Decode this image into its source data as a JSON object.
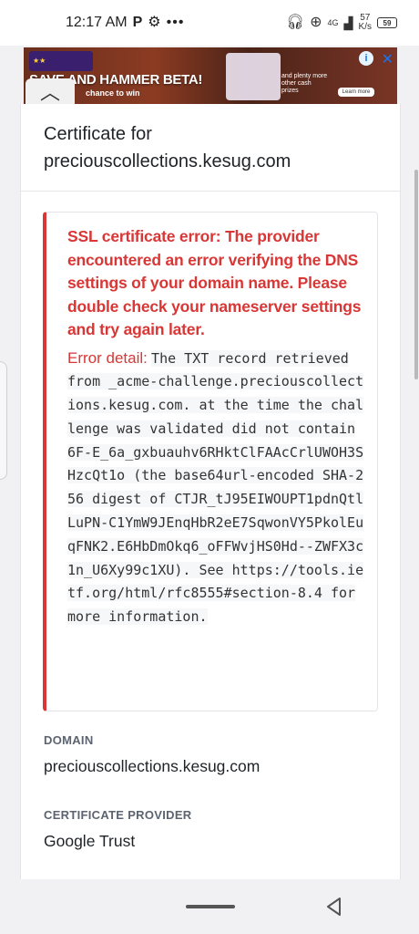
{
  "status_bar": {
    "time": "12:17 AM",
    "left_icons": [
      "parking-icon",
      "gear-icon",
      "more-dots-icon"
    ],
    "right_icons": [
      "headphones-icon",
      "data-saver-icon",
      "signal-icon"
    ],
    "signal_label": "4G",
    "net_speed_value": "57",
    "net_speed_unit": "K/s",
    "battery": "59"
  },
  "ad": {
    "headline": "SAVE AND HAMMER BETA!",
    "subline": "chance to win",
    "cta_text": "and plenty more other cash prizes",
    "cta_button": "Learn more",
    "info_icon": "i",
    "close_icon": "✕"
  },
  "certificate": {
    "heading_line1": "Certificate for",
    "heading_line2": "preciouscollections.kesug.com"
  },
  "error": {
    "title": "SSL certificate error: The provider encountered an error verifying the DNS settings of your domain name. Please double check your nameserver settings and try again later.",
    "detail_label": "Error detail:",
    "detail_text": "The TXT record retrieved from _acme-challenge.preciouscollections.kesug.com. at the time the challenge was validated did not contain 6F-E_6a_gxbuauhv6RHktClFAAcCrlUWOH3SHzcQt1o (the base64url-encoded SHA-256 digest of CTJR_tJ95EIWOUPT1pdnQtlLuPN-C1YmW9JEnqHbR2eE7SqwonVY5PkolEuqFNK2.E6HbDmOkq6_oFFWvjHS0Hd--ZWFX3c1n_U6Xy99c1XU). See https://tools.ietf.org/html/rfc8555#section-8.4 for more information."
  },
  "fields": {
    "domain_label": "DOMAIN",
    "domain_value": "preciouscollections.kesug.com",
    "provider_label": "CERTIFICATE PROVIDER",
    "provider_value": "Google Trust"
  },
  "colors": {
    "error_red": "#d93636",
    "label_gray": "#5b6470"
  }
}
